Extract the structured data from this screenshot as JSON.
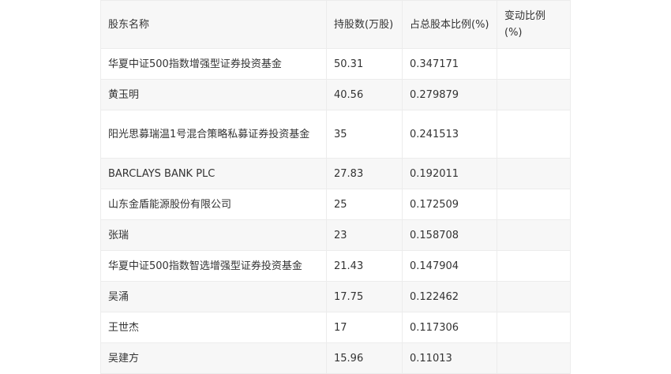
{
  "table": {
    "headers": [
      "股东名称",
      "持股数(万股)",
      "占总股本比例(%)",
      "变动比例(%)"
    ],
    "rows": [
      {
        "name": "华夏中证500指数增强型证券投资基金",
        "shares": "50.31",
        "ratio": "0.347171",
        "change": ""
      },
      {
        "name": "黄玉明",
        "shares": "40.56",
        "ratio": "0.279879",
        "change": ""
      },
      {
        "name": "阳光思募瑞温1号混合策略私募证券投资基金",
        "shares": "35",
        "ratio": "0.241513",
        "change": ""
      },
      {
        "name": "BARCLAYS BANK PLC",
        "shares": "27.83",
        "ratio": "0.192011",
        "change": ""
      },
      {
        "name": "山东金盾能源股份有限公司",
        "shares": "25",
        "ratio": "0.172509",
        "change": ""
      },
      {
        "name": "张瑞",
        "shares": "23",
        "ratio": "0.158708",
        "change": ""
      },
      {
        "name": "华夏中证500指数智选增强型证券投资基金",
        "shares": "21.43",
        "ratio": "0.147904",
        "change": ""
      },
      {
        "name": "吴涌",
        "shares": "17.75",
        "ratio": "0.122462",
        "change": ""
      },
      {
        "name": "王世杰",
        "shares": "17",
        "ratio": "0.117306",
        "change": ""
      },
      {
        "name": "吴建方",
        "shares": "15.96",
        "ratio": "0.11013",
        "change": ""
      }
    ]
  }
}
